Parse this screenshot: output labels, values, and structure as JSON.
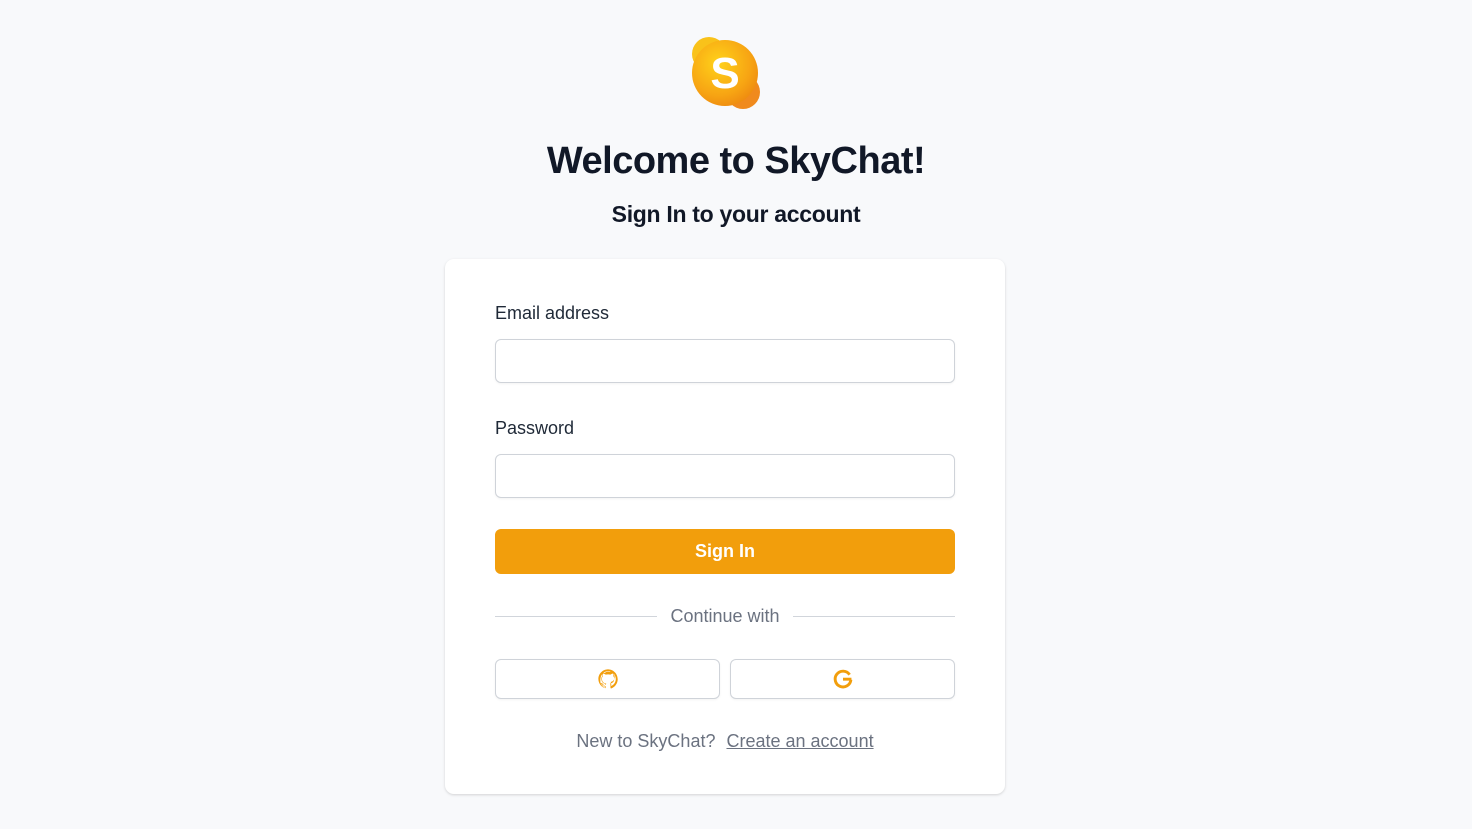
{
  "app": {
    "logo_icon": "skychat-logo-icon",
    "title": "Welcome to SkyChat!",
    "subtitle": "Sign In to your account"
  },
  "form": {
    "email_label": "Email address",
    "email_value": "",
    "email_placeholder": "",
    "password_label": "Password",
    "password_value": "",
    "password_placeholder": "",
    "submit_label": "Sign In"
  },
  "social": {
    "divider_text": "Continue with",
    "providers": [
      {
        "name": "GitHub",
        "icon": "github-icon"
      },
      {
        "name": "Google",
        "icon": "google-icon"
      }
    ]
  },
  "footer": {
    "prompt": "New to SkyChat?",
    "link_text": "Create an account"
  },
  "colors": {
    "accent": "#f29e0c",
    "background": "#f8f9fb",
    "card": "#ffffff",
    "text": "#111827",
    "muted": "#6b7280"
  }
}
